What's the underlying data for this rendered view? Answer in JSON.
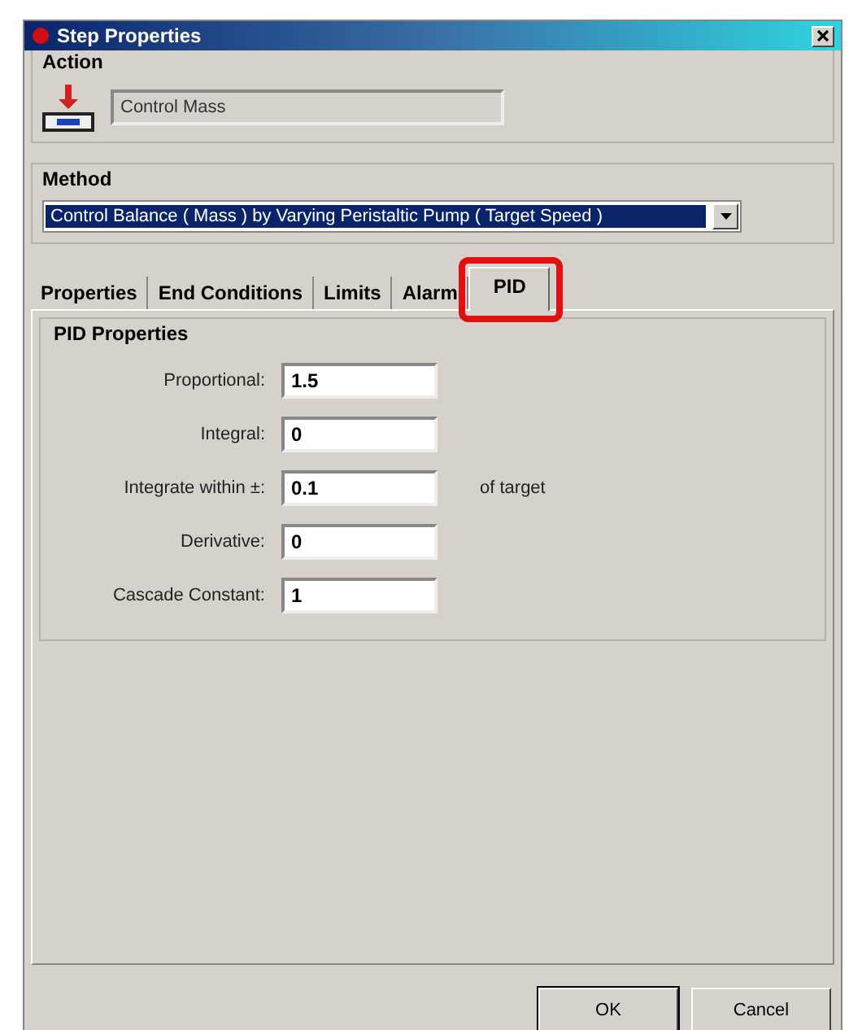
{
  "window": {
    "title": "Step Properties"
  },
  "action": {
    "label": "Action",
    "value": "Control Mass"
  },
  "method": {
    "label": "Method",
    "value": "Control Balance ( Mass ) by Varying Peristaltic Pump ( Target Speed )"
  },
  "tabs": [
    {
      "label": "Properties",
      "selected": false,
      "highlighted": false
    },
    {
      "label": "End Conditions",
      "selected": false,
      "highlighted": false
    },
    {
      "label": "Limits",
      "selected": false,
      "highlighted": false
    },
    {
      "label": "Alarm",
      "selected": false,
      "highlighted": false
    },
    {
      "label": "PID",
      "selected": true,
      "highlighted": true
    }
  ],
  "pid_group": {
    "title": "PID Properties",
    "fields": [
      {
        "label": "Proportional:",
        "value": "1.5"
      },
      {
        "label": "Integral:",
        "value": "0"
      },
      {
        "label": "Integrate within ±:",
        "value": "0.1",
        "suffix": "of target"
      },
      {
        "label": "Derivative:",
        "value": "0"
      },
      {
        "label": "Cascade Constant:",
        "value": "1"
      }
    ]
  },
  "buttons": [
    "OK",
    "Cancel"
  ]
}
